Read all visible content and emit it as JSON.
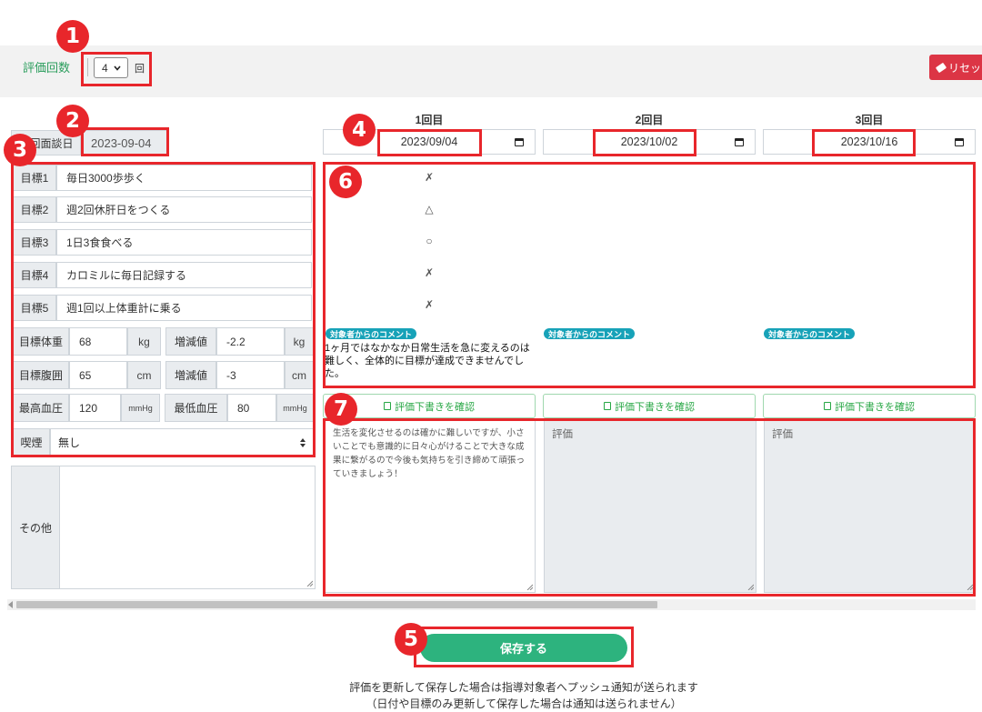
{
  "header": {
    "eval_count_label": "評価回数",
    "eval_count_value": "4",
    "eval_count_unit": "回",
    "reset_label": "リセッ"
  },
  "first_interview": {
    "label": "初回面談日",
    "date": "2023-09-04"
  },
  "goals": [
    {
      "label": "目標1",
      "value": "毎日3000歩歩く"
    },
    {
      "label": "目標2",
      "value": "週2回休肝日をつくる"
    },
    {
      "label": "目標3",
      "value": "1日3食食べる"
    },
    {
      "label": "目標4",
      "value": "カロミルに毎日記録する"
    },
    {
      "label": "目標5",
      "value": "週1回以上体重計に乗る"
    }
  ],
  "metrics": {
    "weight": {
      "label": "目標体重",
      "value": "68",
      "unit": "kg",
      "delta_label": "増減値",
      "delta_value": "-2.2",
      "delta_unit": "kg"
    },
    "waist": {
      "label": "目標腹囲",
      "value": "65",
      "unit": "cm",
      "delta_label": "増減値",
      "delta_value": "-3",
      "delta_unit": "cm"
    },
    "blood_pressure": {
      "high_label": "最高血圧",
      "high_value": "120",
      "high_unit": "mmHg",
      "low_label": "最低血圧",
      "low_value": "80",
      "low_unit": "mmHg"
    }
  },
  "smoking": {
    "label": "喫煙",
    "value": "無し"
  },
  "other": {
    "label": "その他",
    "value": ""
  },
  "rounds": [
    {
      "title": "1回目",
      "date": "2023/09/04",
      "marks": [
        "✗",
        "△",
        "○",
        "✗",
        "✗"
      ],
      "comment_badge": "対象者からのコメント",
      "comment": "1ヶ月ではなかなか日常生活を急に変えるのは難しく、全体的に目標が達成できませんでした。",
      "draft_button": "評価下書きを確認",
      "evaluation": "生活を変化させるのは確かに難しいですが、小さいことでも意識的に日々心がけることで大きな成果に繋がるので今後も気持ちを引き締めて頑張っていきましょう！"
    },
    {
      "title": "2回目",
      "date": "2023/10/02",
      "comment_badge": "対象者からのコメント",
      "draft_button": "評価下書きを確認",
      "evaluation_placeholder": "評価"
    },
    {
      "title": "3回目",
      "date": "2023/10/16",
      "comment_badge": "対象者からのコメント",
      "draft_button": "評価下書きを確認",
      "evaluation_placeholder": "評価"
    }
  ],
  "save_button": "保存する",
  "notice": {
    "line1": "評価を更新して保存した場合は指導対象者へプッシュ通知が送られます",
    "line2": "（日付や目標のみ更新して保存した場合は通知は送られません）"
  },
  "annotations": [
    "1",
    "2",
    "3",
    "4",
    "5",
    "6",
    "7"
  ],
  "colors": {
    "accent_green": "#2a9d5c",
    "save_green": "#2db37e",
    "reset_red": "#dc3545",
    "annotation_red": "#e8262b",
    "badge_teal": "#17a2b8"
  }
}
